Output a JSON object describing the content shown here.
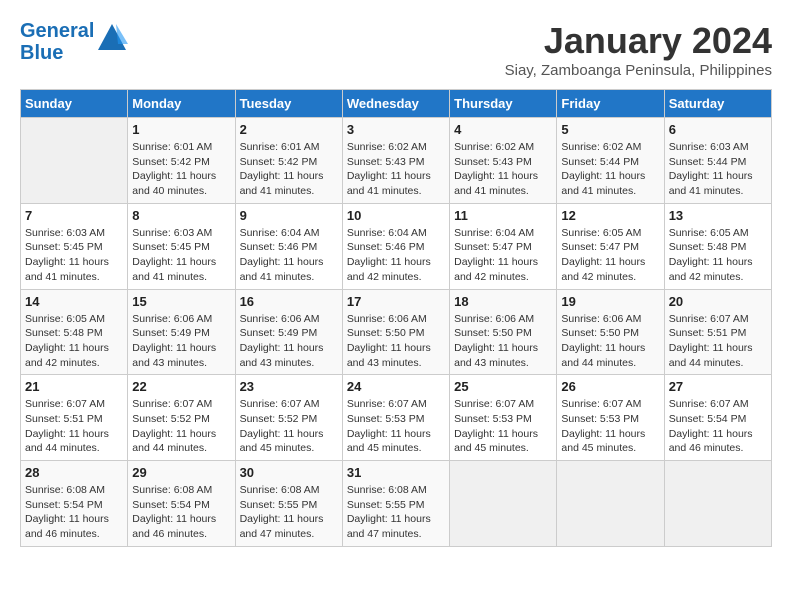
{
  "header": {
    "logo_line1": "General",
    "logo_line2": "Blue",
    "month": "January 2024",
    "location": "Siay, Zamboanga Peninsula, Philippines"
  },
  "days_of_week": [
    "Sunday",
    "Monday",
    "Tuesday",
    "Wednesday",
    "Thursday",
    "Friday",
    "Saturday"
  ],
  "weeks": [
    [
      {
        "day": "",
        "info": ""
      },
      {
        "day": "1",
        "info": "Sunrise: 6:01 AM\nSunset: 5:42 PM\nDaylight: 11 hours\nand 40 minutes."
      },
      {
        "day": "2",
        "info": "Sunrise: 6:01 AM\nSunset: 5:42 PM\nDaylight: 11 hours\nand 41 minutes."
      },
      {
        "day": "3",
        "info": "Sunrise: 6:02 AM\nSunset: 5:43 PM\nDaylight: 11 hours\nand 41 minutes."
      },
      {
        "day": "4",
        "info": "Sunrise: 6:02 AM\nSunset: 5:43 PM\nDaylight: 11 hours\nand 41 minutes."
      },
      {
        "day": "5",
        "info": "Sunrise: 6:02 AM\nSunset: 5:44 PM\nDaylight: 11 hours\nand 41 minutes."
      },
      {
        "day": "6",
        "info": "Sunrise: 6:03 AM\nSunset: 5:44 PM\nDaylight: 11 hours\nand 41 minutes."
      }
    ],
    [
      {
        "day": "7",
        "info": "Sunrise: 6:03 AM\nSunset: 5:45 PM\nDaylight: 11 hours\nand 41 minutes."
      },
      {
        "day": "8",
        "info": "Sunrise: 6:03 AM\nSunset: 5:45 PM\nDaylight: 11 hours\nand 41 minutes."
      },
      {
        "day": "9",
        "info": "Sunrise: 6:04 AM\nSunset: 5:46 PM\nDaylight: 11 hours\nand 41 minutes."
      },
      {
        "day": "10",
        "info": "Sunrise: 6:04 AM\nSunset: 5:46 PM\nDaylight: 11 hours\nand 42 minutes."
      },
      {
        "day": "11",
        "info": "Sunrise: 6:04 AM\nSunset: 5:47 PM\nDaylight: 11 hours\nand 42 minutes."
      },
      {
        "day": "12",
        "info": "Sunrise: 6:05 AM\nSunset: 5:47 PM\nDaylight: 11 hours\nand 42 minutes."
      },
      {
        "day": "13",
        "info": "Sunrise: 6:05 AM\nSunset: 5:48 PM\nDaylight: 11 hours\nand 42 minutes."
      }
    ],
    [
      {
        "day": "14",
        "info": "Sunrise: 6:05 AM\nSunset: 5:48 PM\nDaylight: 11 hours\nand 42 minutes."
      },
      {
        "day": "15",
        "info": "Sunrise: 6:06 AM\nSunset: 5:49 PM\nDaylight: 11 hours\nand 43 minutes."
      },
      {
        "day": "16",
        "info": "Sunrise: 6:06 AM\nSunset: 5:49 PM\nDaylight: 11 hours\nand 43 minutes."
      },
      {
        "day": "17",
        "info": "Sunrise: 6:06 AM\nSunset: 5:50 PM\nDaylight: 11 hours\nand 43 minutes."
      },
      {
        "day": "18",
        "info": "Sunrise: 6:06 AM\nSunset: 5:50 PM\nDaylight: 11 hours\nand 43 minutes."
      },
      {
        "day": "19",
        "info": "Sunrise: 6:06 AM\nSunset: 5:50 PM\nDaylight: 11 hours\nand 44 minutes."
      },
      {
        "day": "20",
        "info": "Sunrise: 6:07 AM\nSunset: 5:51 PM\nDaylight: 11 hours\nand 44 minutes."
      }
    ],
    [
      {
        "day": "21",
        "info": "Sunrise: 6:07 AM\nSunset: 5:51 PM\nDaylight: 11 hours\nand 44 minutes."
      },
      {
        "day": "22",
        "info": "Sunrise: 6:07 AM\nSunset: 5:52 PM\nDaylight: 11 hours\nand 44 minutes."
      },
      {
        "day": "23",
        "info": "Sunrise: 6:07 AM\nSunset: 5:52 PM\nDaylight: 11 hours\nand 45 minutes."
      },
      {
        "day": "24",
        "info": "Sunrise: 6:07 AM\nSunset: 5:53 PM\nDaylight: 11 hours\nand 45 minutes."
      },
      {
        "day": "25",
        "info": "Sunrise: 6:07 AM\nSunset: 5:53 PM\nDaylight: 11 hours\nand 45 minutes."
      },
      {
        "day": "26",
        "info": "Sunrise: 6:07 AM\nSunset: 5:53 PM\nDaylight: 11 hours\nand 45 minutes."
      },
      {
        "day": "27",
        "info": "Sunrise: 6:07 AM\nSunset: 5:54 PM\nDaylight: 11 hours\nand 46 minutes."
      }
    ],
    [
      {
        "day": "28",
        "info": "Sunrise: 6:08 AM\nSunset: 5:54 PM\nDaylight: 11 hours\nand 46 minutes."
      },
      {
        "day": "29",
        "info": "Sunrise: 6:08 AM\nSunset: 5:54 PM\nDaylight: 11 hours\nand 46 minutes."
      },
      {
        "day": "30",
        "info": "Sunrise: 6:08 AM\nSunset: 5:55 PM\nDaylight: 11 hours\nand 47 minutes."
      },
      {
        "day": "31",
        "info": "Sunrise: 6:08 AM\nSunset: 5:55 PM\nDaylight: 11 hours\nand 47 minutes."
      },
      {
        "day": "",
        "info": ""
      },
      {
        "day": "",
        "info": ""
      },
      {
        "day": "",
        "info": ""
      }
    ]
  ]
}
